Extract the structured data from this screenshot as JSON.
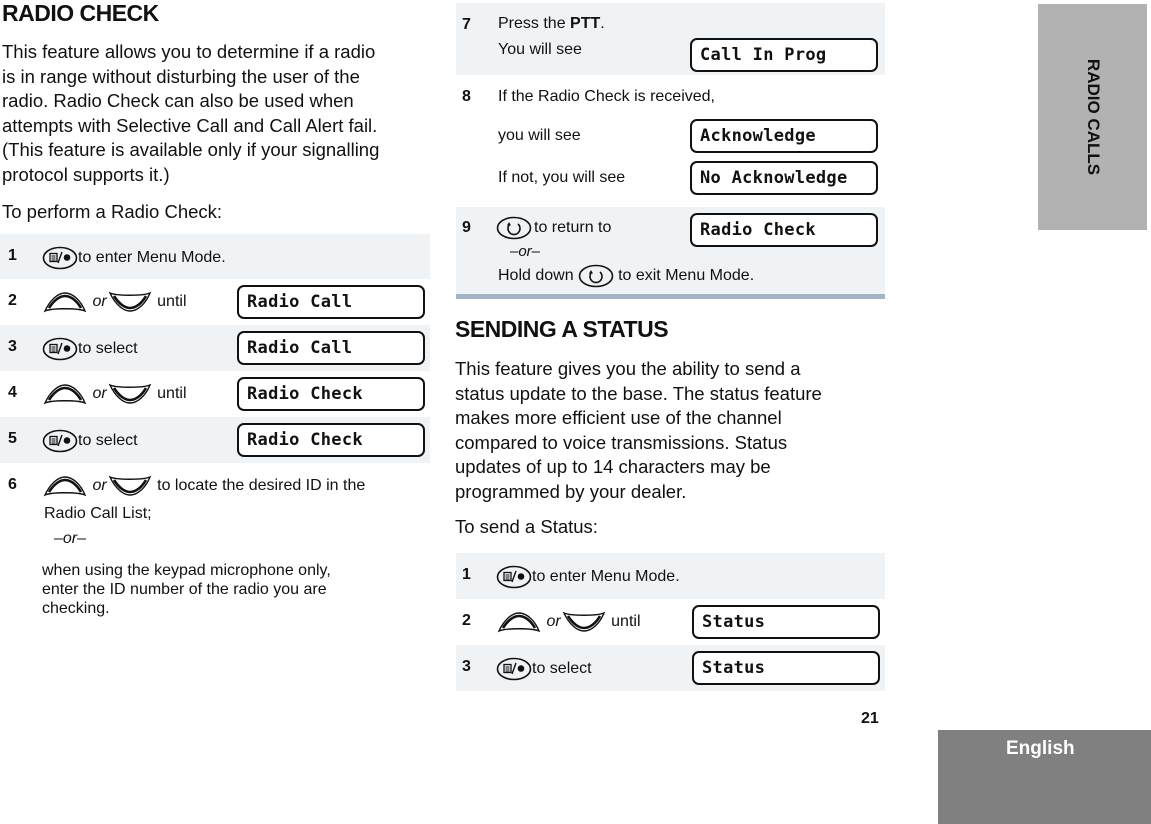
{
  "page": {
    "page_number": "21",
    "side_tab": "RADIO CALLS",
    "language_tab": "English"
  },
  "colors": {
    "row_shade": "#f0f3f6",
    "separator": "#a5b3c6",
    "side_tab_bg": "#b2b2b2",
    "language_tab_bg": "#808080"
  },
  "radio_check": {
    "title": "RADIO CHECK",
    "intro_lines": [
      "This feature allows you to determine if a radio",
      "is in range without disturbing the user of the",
      "radio. Radio Check can also be used when",
      "attempts with Selective Call and Call Alert fail.",
      "(This feature is available only if your signalling",
      "protocol supports it.)"
    ],
    "lead": "To perform a Radio Check:",
    "steps": [
      {
        "num": "1",
        "icon": "menu-select-button-icon",
        "text": "to enter Menu Mode."
      },
      {
        "num": "2",
        "icon": "up-down-arrows-icon",
        "or": "or",
        "text": "until",
        "display": "Radio Call"
      },
      {
        "num": "3",
        "icon": "menu-select-button-icon",
        "text": "to select",
        "display": "Radio Call"
      },
      {
        "num": "4",
        "icon": "up-down-arrows-icon",
        "or": "or",
        "text": "until",
        "display": "Radio Check"
      },
      {
        "num": "5",
        "icon": "menu-select-button-icon",
        "text": "to select",
        "display": "Radio Check"
      },
      {
        "num": "6",
        "icon": "up-down-arrows-icon",
        "or": "or",
        "text": "to locate the desired ID in the",
        "text2": "Radio Call List;",
        "alt": "–or–",
        "alt_lines": [
          "when using the keypad microphone only,",
          "enter the ID number of the radio you are",
          "checking."
        ]
      },
      {
        "num": "7",
        "text_pre": "Press the ",
        "text_bold": "PTT",
        "text_post": ".",
        "text2": "You will see",
        "display": "Call In Prog"
      },
      {
        "num": "8",
        "text": "If the Radio Check is received,",
        "text2": "you will see",
        "display": "Acknowledge",
        "text3": "If not, you will see",
        "display2": "No Acknowledge"
      },
      {
        "num": "9",
        "icon": "home-exit-button-icon",
        "text": "to return to",
        "display": "Radio Check",
        "alt": "–or–",
        "text2_pre": "Hold down",
        "text2_post": "to exit Menu Mode."
      }
    ]
  },
  "sending_status": {
    "title": "SENDING A STATUS",
    "intro_lines": [
      "This feature gives you the ability to send a",
      "status update to the base. The status feature",
      "makes more efficient use of the channel",
      "compared to voice transmissions. Status",
      "updates of up to 14 characters may be",
      "programmed by your dealer."
    ],
    "lead": "To send a Status:",
    "steps": [
      {
        "num": "1",
        "icon": "menu-select-button-icon",
        "text": "to enter Menu Mode."
      },
      {
        "num": "2",
        "icon": "up-down-arrows-icon",
        "or": "or",
        "text": "until",
        "display": "Status"
      },
      {
        "num": "3",
        "icon": "menu-select-button-icon",
        "text": "to select",
        "display": "Status"
      }
    ]
  }
}
